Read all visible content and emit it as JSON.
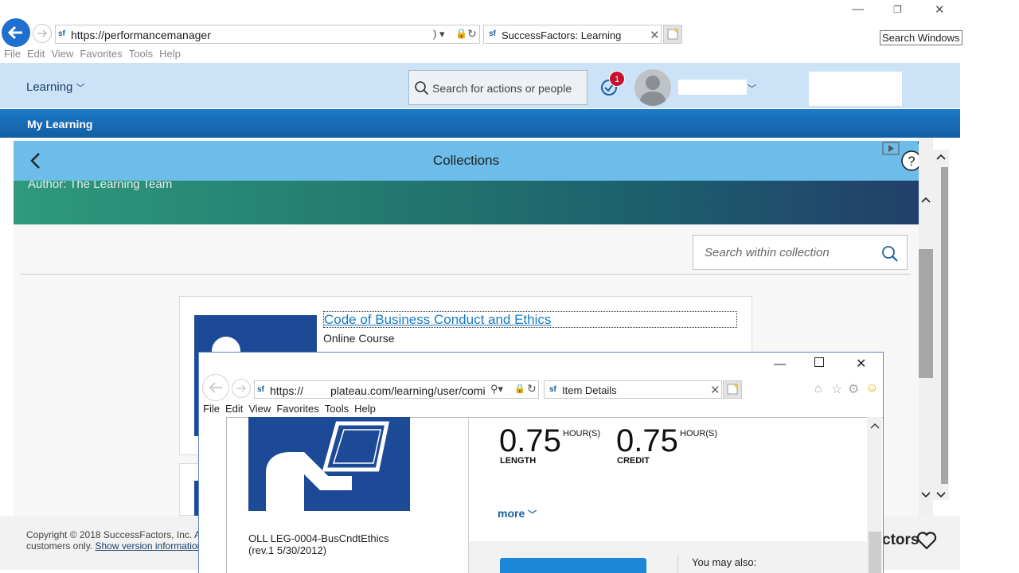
{
  "browser": {
    "url": "https://performancemanager",
    "tab_title": "SuccessFactors: Learning",
    "tooltip": "Search Windows",
    "menu": [
      "File",
      "Edit",
      "View",
      "Favorites",
      "Tools",
      "Help"
    ]
  },
  "header": {
    "module": "Learning",
    "search_placeholder": "Search for actions or people",
    "notification_count": "1"
  },
  "nav": {
    "my_learning": "My Learning"
  },
  "collections": {
    "title": "Collections",
    "author": "Author: The Learning Team",
    "search_placeholder": "Search within collection"
  },
  "course": {
    "title": "Code of Business Conduct and Ethics",
    "type": "Online Course"
  },
  "footer": {
    "copyright": "Copyright © 2018 SuccessFactors, Inc. All r",
    "line2": "customers only.",
    "version_link": "Show version information.",
    "brand_tail": "ctors"
  },
  "popup": {
    "url_prefix": "https://",
    "url_rest": "plateau.com/learning/user/comi",
    "tab_title": "Item Details",
    "menu": [
      "File",
      "Edit",
      "View",
      "Favorites",
      "Tools",
      "Help"
    ],
    "length_value": "0.75",
    "length_unit": "HOUR(S)",
    "length_label": "LENGTH",
    "credit_value": "0.75",
    "credit_unit": "HOUR(S)",
    "credit_label": "CREDIT",
    "more": "more",
    "code_line1": "OLL LEG-0004-BusCndtEthics",
    "code_line2": "(rev.1 5/30/2012)",
    "you_may_also": "You may also:"
  },
  "colors": {
    "header_bg": "#cce3f7",
    "nav_bar": "#1670b8",
    "collections_bar": "#6cbde9",
    "link": "#1a7bc2",
    "badge": "#c8102e"
  }
}
